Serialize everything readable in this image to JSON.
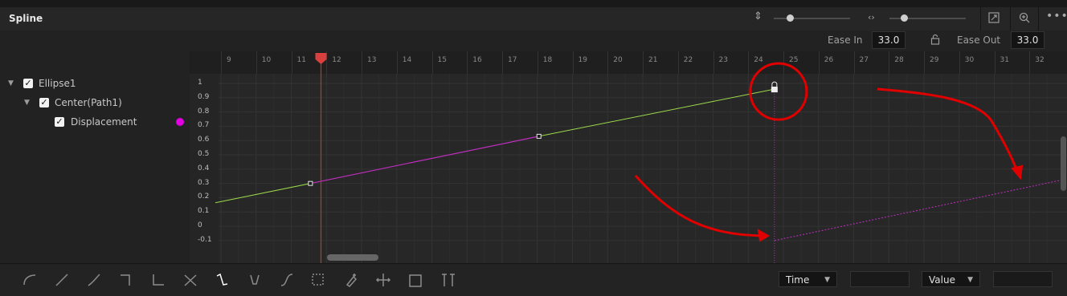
{
  "panel": {
    "title": "Spline"
  },
  "header_icons": {
    "sort": "vertical-arrows-icon",
    "zoom_h": "horizontal-arrows-icon",
    "fit": "fit-to-window-icon",
    "zoom": "zoom-icon",
    "more": "more-options-icon"
  },
  "ease": {
    "in_label": "Ease In",
    "in_value": "33.0",
    "lock": "lock-icon",
    "out_label": "Ease Out",
    "out_value": "33.0"
  },
  "tree": {
    "items": [
      {
        "label": "Ellipse1",
        "checked": true,
        "expanded": true
      },
      {
        "label": "Center(Path1)",
        "checked": true,
        "expanded": true
      },
      {
        "label": "Displacement",
        "checked": true,
        "color": "#e100e1"
      }
    ]
  },
  "ruler": {
    "frames": [
      "9",
      "10",
      "11",
      "12",
      "13",
      "14",
      "15",
      "16",
      "17",
      "18",
      "19",
      "20",
      "21",
      "22",
      "23",
      "24",
      "25",
      "26",
      "27",
      "28",
      "29",
      "30",
      "31",
      "32"
    ],
    "playhead_frame": 11.8
  },
  "y_axis": {
    "labels": [
      "1",
      "0.9",
      "0.8",
      "0.7",
      "0.6",
      "0.5",
      "0.4",
      "0.3",
      "0.2",
      "0.1",
      "0",
      "-0.1"
    ]
  },
  "curve": {
    "keyframes": [
      {
        "frame": 11.5,
        "value": 0.3
      },
      {
        "frame": 18,
        "value": 0.63
      },
      {
        "frame": 24.7,
        "value": 0.96
      }
    ],
    "extrapolation_start": {
      "frame": 24.7,
      "value": -0.1
    },
    "colors": {
      "tangent": "#9ad94a",
      "curve": "#c02ec0",
      "annotation": "#e00000"
    }
  },
  "toolbar": {
    "tools": [
      "smooth-icon",
      "linear-icon",
      "invert-icon",
      "step-in-icon",
      "step-out-icon",
      "reverse-icon",
      "select-all-icon",
      "ease-in-out-icon",
      "s-curve-icon",
      "select-rect-icon",
      "add-point-icon",
      "time-stretch-icon",
      "shape-box-icon",
      "set-key-icon"
    ],
    "time_select": "Time",
    "value_select": "Value"
  }
}
